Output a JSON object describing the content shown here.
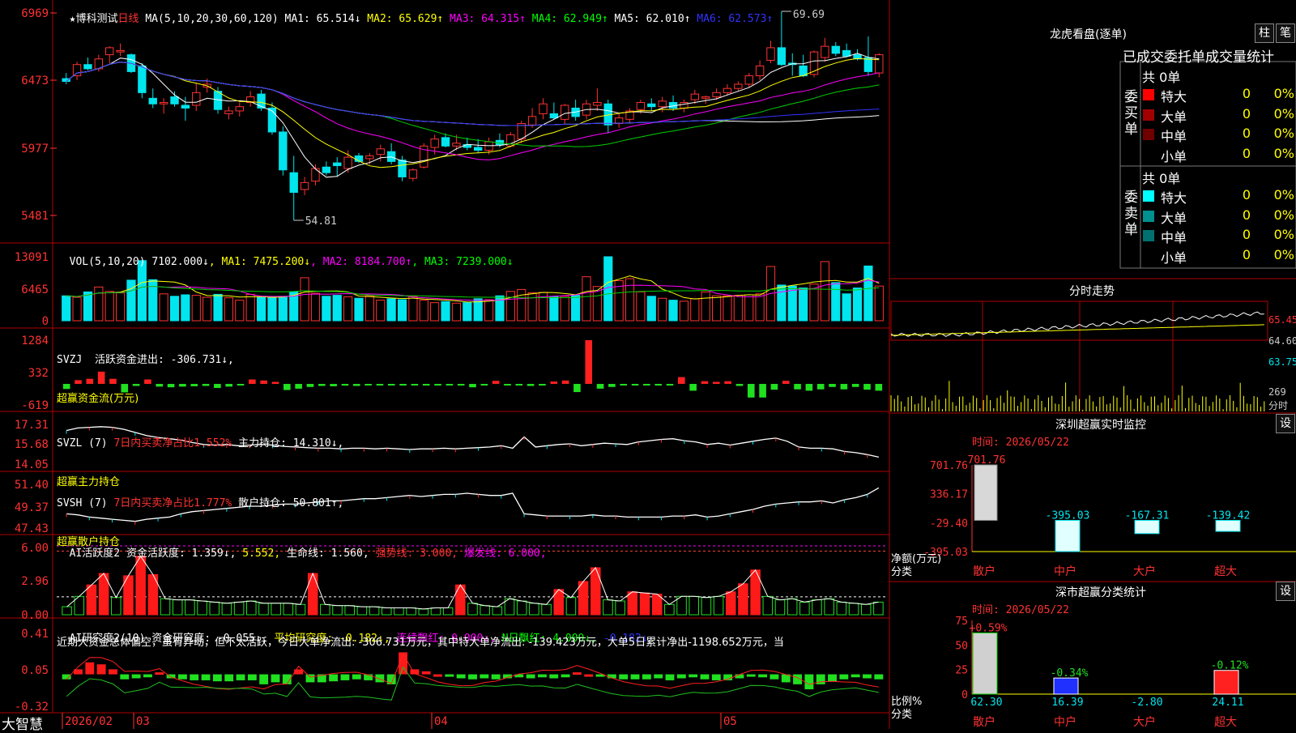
{
  "colors": {
    "up": "#ff3232",
    "down": "#00e5ee",
    "grid": "#b00000",
    "yellow": "#ffff00",
    "white": "#ffffff",
    "magenta": "#ff00ff",
    "green": "#00d000",
    "blue": "#3232ff"
  },
  "header": {
    "star": "★",
    "stock_name": "博科测试",
    "period": "日线",
    "ma_params": "MA(5,10,20,30,60,120)",
    "ma_values": [
      {
        "label": "MA1: 65.514↓",
        "color": "#ffffff"
      },
      {
        "label": "MA2: 65.629↑",
        "color": "#ffff00"
      },
      {
        "label": "MA3: 64.315↑",
        "color": "#ff00ff"
      },
      {
        "label": "MA4: 62.949↑",
        "color": "#00ff00"
      },
      {
        "label": "MA5: 62.010↑",
        "color": "#ffffff"
      },
      {
        "label": "MA6: 62.573↑",
        "color": "#3232ff"
      }
    ]
  },
  "main": {
    "y_ticks": [
      "6969",
      "6473",
      "5977",
      "5481"
    ],
    "high_label": "69.69",
    "low_label": "54.81"
  },
  "vol": {
    "title": "VOL(5,10,20)",
    "value": "7102.000↓",
    "ma": [
      {
        "label": "MA1: 7475.200↓",
        "color": "#ffff00"
      },
      {
        "label": "MA2: 8184.700↑",
        "color": "#ff00ff"
      },
      {
        "label": "MA3: 7239.000↓",
        "color": "#00ff00"
      }
    ],
    "y_ticks": [
      "13091",
      "6465",
      "0"
    ]
  },
  "svzj": {
    "line1": "SVZJ  活跃资金进出: -306.731↓,",
    "line2": "超赢资金流(万元)",
    "y_ticks": [
      "1284",
      "332",
      "-619"
    ]
  },
  "svzl": {
    "title": "SVZL (7)",
    "red_text": "7日内买卖净占比1.552%",
    "white_text": "主力持仓: 14.310↓,",
    "line2": "超赢主力持仓",
    "y_ticks": [
      "17.31",
      "15.68",
      "14.05"
    ]
  },
  "svsh": {
    "title": "SVSH (7)",
    "red_text": "7日内买卖净占比1.777%",
    "white_text": "散户持仓: 50.801↑,",
    "line2": "超赢散户持仓",
    "y_ticks": [
      "51.40",
      "49.37",
      "47.43"
    ]
  },
  "ai_active": {
    "title": "AI活跃度2 资金活跃度: 1.359↓,",
    "val2": "5.552,",
    "life": "生命线: 1.560,",
    "strong": "强势线: 3.000,",
    "burst": "爆发线: 6.000,",
    "y_ticks": [
      "6.00",
      "2.96",
      "0.00"
    ]
  },
  "ai_research": {
    "title": "AI研究度2(10) 资金研究度: -0.055↓,",
    "avg": "平均研究度: -0.182↓,",
    "cont": "连续飘红: 0.000↓,",
    "n": "N日飘红: 4.000↓,",
    "tail": "-0.182↓",
    "comment": "近期大资金总体偏空，虽有异动，但不太活跃，今日大单净流出: -306.731万元，其中特大单净流出: -139.423万元，大单5日累计净出-1198.652万元，当",
    "y_ticks": [
      "0.41",
      "0.05",
      "-0.32"
    ]
  },
  "bottom": {
    "brand": "大智慧",
    "dates": [
      "2026/02",
      "03",
      "04",
      "05"
    ]
  },
  "lhb": {
    "title": "龙虎看盘(逐单)",
    "btn_zhu": "柱",
    "btn_bi": "笔",
    "header": "已成交委托单成交量统计",
    "buy_label": "委买单",
    "sell_label": "委卖单",
    "buy_total": "共 0单",
    "sell_total": "共 0单",
    "buy_rows": [
      {
        "name": "特大",
        "value": "0",
        "pct": "0%",
        "color": "#ff0000"
      },
      {
        "name": "大单",
        "value": "0",
        "pct": "0%",
        "color": "#a00000"
      },
      {
        "name": "中单",
        "value": "0",
        "pct": "0%",
        "color": "#700000"
      },
      {
        "name": "小单",
        "value": "0",
        "pct": "0%",
        "color": ""
      }
    ],
    "sell_rows": [
      {
        "name": "特大",
        "value": "0",
        "pct": "0%",
        "color": "#00ffff"
      },
      {
        "name": "大单",
        "value": "0",
        "pct": "0%",
        "color": "#009090"
      },
      {
        "name": "中单",
        "value": "0",
        "pct": "0%",
        "color": "#007070"
      },
      {
        "name": "小单",
        "value": "0",
        "pct": "0%",
        "color": ""
      }
    ]
  },
  "intraday": {
    "title": "分时走势",
    "y_ticks": [
      "65.45",
      "64.60",
      "63.75"
    ],
    "vol_tick": "269",
    "vol_label": "分时"
  },
  "sz_monitor": {
    "title": "深圳超赢实时监控",
    "btn": "设",
    "time": "时间: 2026/05/22",
    "y_ticks": [
      "701.76",
      "336.17",
      "-29.40",
      "-395.03"
    ],
    "y_label": "净额(万元)",
    "x_label": "分类",
    "categories": [
      "散户",
      "中户",
      "大户",
      "超大"
    ],
    "values": [
      701.76,
      -395.03,
      -167.31,
      -139.42
    ],
    "labels": [
      "701.76",
      "-395.03",
      "-167.31",
      "-139.42"
    ]
  },
  "sz_stats": {
    "title": "深市超赢分类统计",
    "btn": "设",
    "time": "时间: 2026/05/22",
    "y_ticks": [
      "75",
      "50",
      "25",
      "0"
    ],
    "y_label": "比例%",
    "x_label": "分类",
    "categories": [
      "散户",
      "中户",
      "大户",
      "超大"
    ],
    "pct_labels": [
      "+0.59%",
      "-0.34%",
      "",
      "-0.12%"
    ],
    "values": [
      62.3,
      16.39,
      -2.8,
      24.11
    ],
    "value_labels": [
      "62.30",
      "16.39",
      "-2.80",
      "24.11"
    ]
  },
  "chart_data": [
    {
      "type": "candlestick",
      "title": "博科测试 日线",
      "ylim": [
        54.81,
        69.69
      ],
      "ohlc": [
        [
          64.9,
          65.3,
          64.5,
          64.7
        ],
        [
          65.1,
          66.1,
          64.8,
          65.9
        ],
        [
          65.9,
          66.4,
          65.5,
          65.6
        ],
        [
          65.6,
          66.6,
          65.4,
          66.3
        ],
        [
          66.6,
          67.2,
          66.0,
          67.1
        ],
        [
          66.8,
          67.4,
          66.5,
          66.9
        ],
        [
          66.6,
          66.7,
          65.3,
          65.4
        ],
        [
          65.8,
          66.0,
          63.5,
          63.9
        ],
        [
          63.5,
          64.2,
          62.8,
          63.1
        ],
        [
          63.1,
          63.5,
          62.4,
          63.2
        ],
        [
          63.6,
          64.0,
          62.9,
          63.1
        ],
        [
          63.0,
          63.6,
          61.9,
          62.8
        ],
        [
          63.0,
          64.6,
          62.6,
          63.9
        ],
        [
          64.3,
          64.9,
          63.9,
          64.5
        ],
        [
          64.0,
          64.3,
          62.4,
          62.7
        ],
        [
          62.4,
          62.9,
          62.0,
          62.6
        ],
        [
          62.6,
          63.2,
          62.2,
          62.9
        ],
        [
          63.2,
          64.0,
          62.9,
          63.6
        ],
        [
          63.8,
          64.1,
          62.6,
          62.8
        ],
        [
          62.8,
          63.2,
          60.9,
          61.1
        ],
        [
          61.1,
          61.5,
          58.0,
          58.4
        ],
        [
          58.2,
          59.4,
          54.81,
          56.8
        ],
        [
          57.0,
          57.9,
          56.6,
          57.5
        ],
        [
          57.6,
          58.8,
          57.3,
          58.5
        ],
        [
          58.6,
          59.0,
          58.0,
          58.2
        ],
        [
          58.9,
          59.3,
          57.9,
          58.7
        ],
        [
          58.5,
          59.8,
          58.2,
          59.3
        ],
        [
          59.4,
          59.6,
          58.9,
          59.0
        ],
        [
          59.2,
          59.6,
          58.8,
          59.4
        ],
        [
          59.5,
          60.2,
          59.0,
          59.9
        ],
        [
          59.7,
          60.3,
          58.8,
          59.0
        ],
        [
          59.1,
          59.4,
          57.6,
          57.9
        ],
        [
          57.8,
          58.5,
          57.6,
          58.4
        ],
        [
          58.6,
          60.3,
          58.5,
          60.1
        ],
        [
          60.0,
          60.9,
          59.5,
          60.6
        ],
        [
          60.7,
          61.0,
          60.0,
          60.1
        ],
        [
          60.1,
          60.9,
          59.8,
          60.3
        ],
        [
          60.2,
          60.7,
          59.8,
          60.0
        ],
        [
          60.0,
          60.6,
          59.6,
          59.8
        ],
        [
          59.8,
          60.7,
          59.5,
          60.4
        ],
        [
          60.5,
          61.0,
          60.0,
          60.2
        ],
        [
          60.1,
          61.1,
          60.0,
          60.9
        ],
        [
          60.6,
          61.9,
          60.3,
          61.7
        ],
        [
          61.6,
          62.8,
          61.4,
          62.2
        ],
        [
          62.4,
          63.5,
          62.0,
          63.1
        ],
        [
          62.4,
          63.2,
          62.0,
          62.1
        ],
        [
          62.0,
          63.1,
          61.7,
          63.0
        ],
        [
          62.8,
          63.4,
          61.9,
          62.2
        ],
        [
          62.3,
          63.4,
          62.0,
          63.1
        ],
        [
          63.0,
          64.2,
          62.6,
          63.2
        ],
        [
          63.1,
          63.4,
          61.0,
          61.6
        ],
        [
          61.7,
          62.4,
          61.4,
          62.1
        ],
        [
          62.0,
          62.8,
          61.7,
          62.6
        ],
        [
          62.7,
          63.4,
          62.4,
          63.2
        ],
        [
          63.1,
          63.5,
          62.6,
          62.9
        ],
        [
          62.9,
          63.6,
          62.5,
          63.3
        ],
        [
          63.2,
          63.7,
          62.6,
          62.8
        ],
        [
          62.8,
          63.4,
          62.5,
          63.2
        ],
        [
          63.4,
          64.1,
          63.1,
          63.8
        ],
        [
          63.5,
          63.7,
          63.1,
          63.6
        ],
        [
          63.6,
          64.2,
          63.4,
          63.9
        ],
        [
          63.9,
          64.5,
          63.7,
          64.2
        ],
        [
          64.2,
          64.7,
          64.0,
          64.5
        ],
        [
          64.5,
          65.3,
          64.3,
          65.1
        ],
        [
          65.1,
          66.2,
          64.8,
          65.8
        ],
        [
          66.2,
          67.6,
          66.0,
          67.1
        ],
        [
          67.1,
          69.69,
          65.8,
          65.9
        ],
        [
          66.0,
          66.7,
          65.1,
          65.9
        ],
        [
          65.8,
          66.6,
          65.0,
          65.1
        ],
        [
          65.2,
          66.9,
          65.0,
          66.8
        ],
        [
          66.4,
          67.8,
          66.1,
          67.2
        ],
        [
          67.2,
          67.5,
          66.5,
          66.7
        ],
        [
          66.9,
          67.4,
          66.4,
          66.5
        ],
        [
          66.6,
          67.0,
          66.2,
          66.3
        ],
        [
          66.4,
          67.9,
          65.1,
          65.4
        ],
        [
          65.3,
          66.7,
          65.0,
          66.6
        ]
      ]
    },
    {
      "type": "bar",
      "title": "VOL(5,10,20)",
      "ylim": [
        0,
        13091
      ],
      "values": [
        5100,
        4800,
        5900,
        6900,
        6000,
        5700,
        8300,
        12300,
        8400,
        5500,
        5000,
        5300,
        5200,
        4800,
        5400,
        4700,
        4200,
        5400,
        4900,
        4800,
        5000,
        5900,
        8800,
        5600,
        5000,
        5200,
        4900,
        4600,
        5100,
        4200,
        4500,
        4300,
        5000,
        4200,
        3700,
        3900,
        3600,
        3700,
        4500,
        4300,
        5100,
        6000,
        6400,
        5700,
        5800,
        4900,
        5000,
        5200,
        9000,
        7000,
        13091,
        8200,
        8600,
        5900,
        5000,
        4600,
        4200,
        4000,
        4500,
        5900,
        5100,
        5100,
        5200,
        5300,
        5500,
        11100,
        7300,
        7100,
        6700,
        7500,
        12100,
        7800,
        5500,
        6700,
        11200,
        7100
      ]
    },
    {
      "type": "bar",
      "title": "SVZJ",
      "ylim": [
        -619,
        1284
      ],
      "values": [
        -150,
        110,
        150,
        360,
        150,
        -250,
        -60,
        130,
        -80,
        -100,
        -80,
        -70,
        -60,
        -120,
        -80,
        -40,
        130,
        100,
        60,
        -180,
        -140,
        -90,
        -60,
        -70,
        -50,
        -60,
        -40,
        -30,
        -40,
        -30,
        -20,
        -40,
        -20,
        -30,
        -40,
        -100,
        -30,
        90,
        -40,
        -40,
        -60,
        -20,
        70,
        100,
        -240,
        1284,
        -140,
        -90,
        -30,
        -30,
        -40,
        -20,
        -30,
        200,
        -200,
        80,
        60,
        80,
        -60,
        -400,
        -400,
        -170,
        90,
        -160,
        -200,
        -160,
        -90,
        -160,
        -90,
        -170,
        -200
      ]
    },
    {
      "type": "line",
      "title": "SVZL (7)",
      "ylim": [
        14.05,
        17.31
      ],
      "values": [
        16.7,
        16.9,
        16.95,
        17.0,
        16.95,
        16.8,
        16.55,
        16.3,
        16.15,
        16.05,
        15.95,
        15.75,
        15.6,
        15.55,
        15.6,
        15.5,
        15.55,
        15.6,
        15.55,
        15.45,
        15.4,
        15.35,
        15.3,
        15.3,
        15.25,
        15.3,
        15.3,
        15.25,
        15.3,
        15.25,
        15.2,
        15.25,
        15.25,
        15.3,
        15.25,
        15.3,
        15.35,
        15.4,
        15.5,
        15.3,
        16.2,
        15.4,
        15.5,
        15.6,
        15.65,
        15.5,
        15.6,
        15.7,
        15.65,
        15.6,
        15.8,
        15.9,
        16.0,
        16.05,
        15.9,
        15.8,
        15.6,
        15.7,
        15.55,
        15.7,
        15.85,
        16.0,
        16.1,
        15.85,
        15.4,
        15.3,
        15.3,
        15.25,
        15.05,
        14.95,
        14.8,
        14.6
      ]
    },
    {
      "type": "line",
      "title": "SVSH (7)",
      "ylim": [
        47.43,
        51.4
      ],
      "values": [
        48.6,
        48.5,
        48.3,
        48.2,
        48.1,
        48.0,
        47.9,
        48.1,
        48.2,
        48.3,
        48.6,
        48.8,
        48.9,
        49.0,
        49.1,
        49.2,
        49.3,
        49.3,
        49.4,
        49.5,
        49.5,
        49.6,
        49.7,
        49.8,
        49.8,
        49.9,
        50.0,
        50.0,
        50.1,
        50.2,
        50.3,
        50.2,
        50.3,
        50.4,
        50.4,
        50.5,
        50.4,
        50.3,
        50.3,
        50.5,
        48.6,
        48.5,
        48.4,
        48.4,
        48.4,
        48.4,
        48.5,
        48.4,
        48.4,
        48.3,
        48.3,
        48.3,
        48.3,
        48.4,
        48.4,
        48.5,
        48.3,
        48.4,
        48.6,
        48.8,
        49.0,
        49.3,
        49.5,
        49.6,
        49.7,
        49.7,
        49.8,
        49.6,
        49.9,
        50.1,
        50.4,
        51.0
      ]
    },
    {
      "type": "bar",
      "title": "AI活跃度2",
      "ylim": [
        0,
        6
      ],
      "values": [
        0.7,
        1.6,
        2.6,
        3.6,
        1.5,
        3.4,
        5.1,
        3.5,
        1.4,
        1.3,
        1.3,
        1.2,
        1.1,
        1.0,
        1.1,
        1.2,
        1.0,
        1.0,
        1.0,
        0.9,
        3.6,
        0.9,
        0.8,
        0.8,
        0.7,
        0.7,
        0.6,
        0.6,
        0.6,
        0.5,
        0.6,
        0.6,
        2.6,
        1.0,
        0.8,
        0.7,
        1.4,
        1.2,
        1.0,
        0.9,
        2.2,
        1.5,
        2.9,
        4.1,
        1.3,
        1.2,
        2.0,
        1.9,
        1.8,
        0.9,
        1.6,
        1.6,
        1.5,
        1.6,
        2.0,
        2.7,
        3.9,
        1.6,
        1.3,
        1.4,
        1.1,
        1.3,
        1.4,
        1.1,
        1.0,
        0.9,
        1.1
      ]
    },
    {
      "type": "bar",
      "title": "AI研究度2(10)",
      "ylim": [
        -0.32,
        0.41
      ],
      "values": [
        -0.05,
        0.05,
        0.12,
        0.1,
        0.05,
        -0.05,
        -0.04,
        -0.03,
        0.02,
        -0.04,
        -0.05,
        -0.06,
        -0.06,
        -0.07,
        -0.07,
        -0.06,
        -0.06,
        -0.1,
        -0.08,
        -0.1,
        0.05,
        -0.08,
        -0.08,
        -0.07,
        -0.06,
        -0.05,
        -0.06,
        -0.08,
        -0.1,
        0.22,
        0.05,
        0.03,
        0.0,
        -0.02,
        -0.04,
        -0.05,
        -0.04,
        -0.05,
        -0.04,
        -0.03,
        -0.04,
        -0.03,
        -0.04,
        -0.03,
        0.02,
        0.0,
        -0.02,
        -0.04,
        -0.05,
        -0.05,
        -0.05,
        -0.04,
        -0.06,
        -0.04,
        -0.03,
        -0.05,
        -0.06,
        -0.06,
        -0.04,
        -0.02,
        -0.03,
        -0.05,
        -0.08,
        -0.1,
        -0.15,
        -0.1,
        -0.07,
        -0.05,
        -0.03,
        -0.04,
        -0.05
      ]
    },
    {
      "type": "bar",
      "title": "深圳超赢实时监控",
      "categories": [
        "散户",
        "中户",
        "大户",
        "超大"
      ],
      "values": [
        701.76,
        -395.03,
        -167.31,
        -139.42
      ],
      "ylim": [
        -395.03,
        701.76
      ],
      "ylabel": "净额(万元)",
      "xlabel": "分类"
    },
    {
      "type": "bar",
      "title": "深市超赢分类统计",
      "categories": [
        "散户",
        "中户",
        "大户",
        "超大"
      ],
      "values": [
        62.3,
        16.39,
        -2.8,
        24.11
      ],
      "ylim": [
        0,
        75
      ],
      "ylabel": "比例%",
      "xlabel": "分类"
    }
  ]
}
